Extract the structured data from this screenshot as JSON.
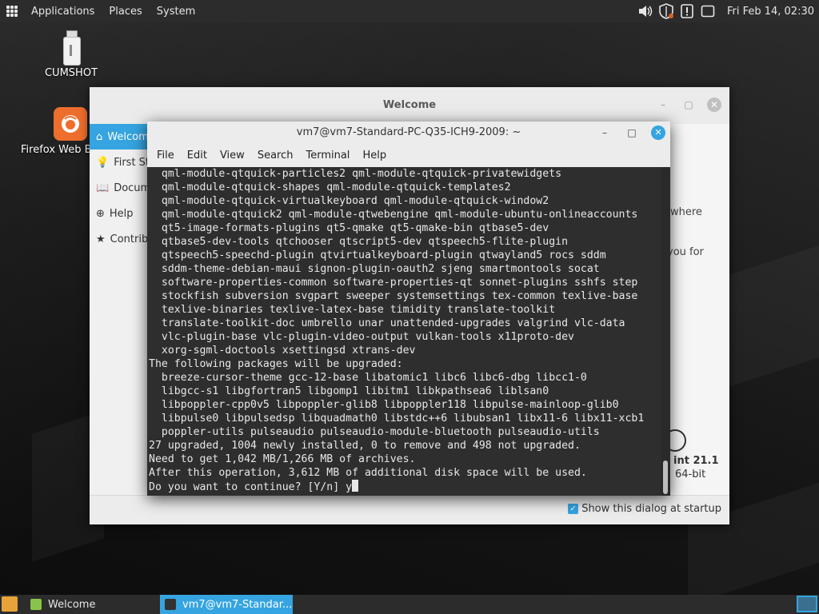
{
  "top_panel": {
    "menus": [
      "Applications",
      "Places",
      "System"
    ],
    "clock": "Fri Feb 14, 02:30",
    "tray_icons": [
      "volume-icon",
      "shield-icon",
      "update-alert-icon",
      "workspace-icon"
    ]
  },
  "desktop_icons": [
    {
      "label": "CUMSHOT",
      "icon": "usb-drive-icon"
    },
    {
      "label": "Firefox Web B",
      "icon": "firefox-icon"
    }
  ],
  "welcome": {
    "title": "Welcome",
    "sidebar": [
      "Welcome",
      "First Steps",
      "Documentation",
      "Help",
      "Contribute"
    ],
    "body_fragments": [
      "where",
      "you for"
    ],
    "version_label": "int 21.1",
    "arch_label": "64-bit",
    "show_startup_label": "Show this dialog at startup",
    "show_startup_checked": true
  },
  "terminal": {
    "title": "vm7@vm7-Standard-PC-Q35-ICH9-2009: ~",
    "menu": [
      "File",
      "Edit",
      "View",
      "Search",
      "Terminal",
      "Help"
    ],
    "lines": [
      "  qml-module-qtquick-particles2 qml-module-qtquick-privatewidgets",
      "  qml-module-qtquick-shapes qml-module-qtquick-templates2",
      "  qml-module-qtquick-virtualkeyboard qml-module-qtquick-window2",
      "  qml-module-qtquick2 qml-module-qtwebengine qml-module-ubuntu-onlineaccounts",
      "  qt5-image-formats-plugins qt5-qmake qt5-qmake-bin qtbase5-dev",
      "  qtbase5-dev-tools qtchooser qtscript5-dev qtspeech5-flite-plugin",
      "  qtspeech5-speechd-plugin qtvirtualkeyboard-plugin qtwayland5 rocs sddm",
      "  sddm-theme-debian-maui signon-plugin-oauth2 sjeng smartmontools socat",
      "  software-properties-common software-properties-qt sonnet-plugins sshfs step",
      "  stockfish subversion svgpart sweeper systemsettings tex-common texlive-base",
      "  texlive-binaries texlive-latex-base timidity translate-toolkit",
      "  translate-toolkit-doc umbrello unar unattended-upgrades valgrind vlc-data",
      "  vlc-plugin-base vlc-plugin-video-output vulkan-tools x11proto-dev",
      "  xorg-sgml-doctools xsettingsd xtrans-dev",
      "The following packages will be upgraded:",
      "  breeze-cursor-theme gcc-12-base libatomic1 libc6 libc6-dbg libcc1-0",
      "  libgcc-s1 libgfortran5 libgomp1 libitm1 libkpathsea6 liblsan0",
      "  libpoppler-cpp0v5 libpoppler-glib8 libpoppler118 libpulse-mainloop-glib0",
      "  libpulse0 libpulsedsp libquadmath0 libstdc++6 libubsan1 libx11-6 libx11-xcb1",
      "  poppler-utils pulseaudio pulseaudio-module-bluetooth pulseaudio-utils",
      "27 upgraded, 1004 newly installed, 0 to remove and 498 not upgraded.",
      "Need to get 1,042 MB/1,266 MB of archives.",
      "After this operation, 3,612 MB of additional disk space will be used.",
      "Do you want to continue? [Y/n] y"
    ]
  },
  "taskbar": {
    "items": [
      {
        "label": "Welcome",
        "icon": "mint-welcome-icon",
        "active": false
      },
      {
        "label": "vm7@vm7-Standar...",
        "icon": "terminal-icon",
        "active": true
      }
    ]
  }
}
